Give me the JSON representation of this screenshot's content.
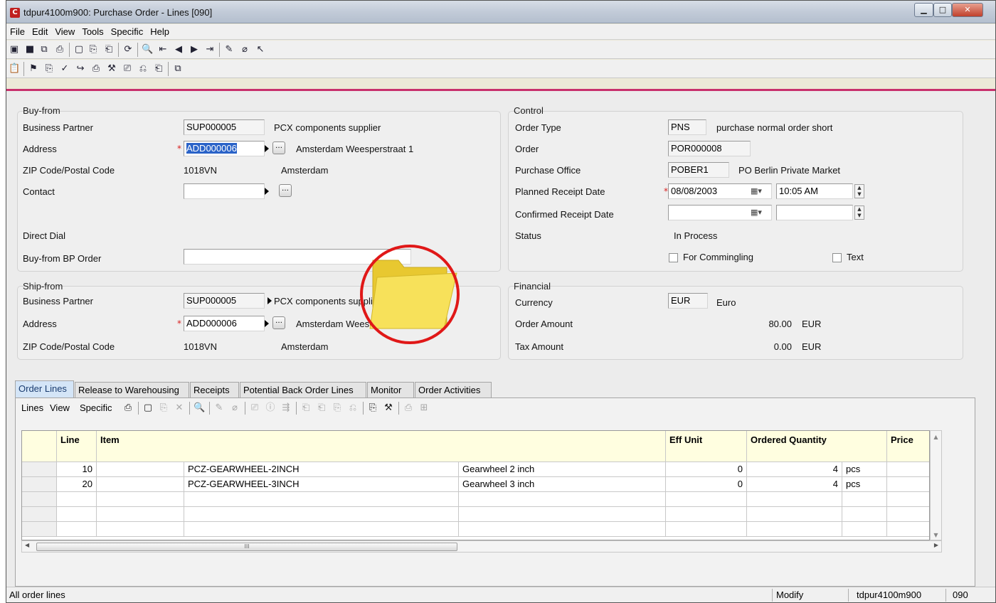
{
  "window": {
    "title": "tdpur4100m900: Purchase Order - Lines [090]",
    "app_icon": "C"
  },
  "menu": [
    "File",
    "Edit",
    "View",
    "Tools",
    "Specific",
    "Help"
  ],
  "buy_from": {
    "group_title": "Buy-from",
    "bp_label": "Business Partner",
    "bp_value": "SUP000005",
    "bp_name": "PCX components supplier",
    "address_label": "Address",
    "address_value": "ADD000006",
    "address_text": "Amsterdam Weesperstraat 1",
    "zip_label": "ZIP Code/Postal Code",
    "zip_value": "1018VN",
    "city": "Amsterdam",
    "contact_label": "Contact",
    "contact_value": "",
    "direct_dial_label": "Direct Dial",
    "bp_order_label": "Buy-from BP Order",
    "bp_order_value": ""
  },
  "control": {
    "group_title": "Control",
    "order_type_label": "Order Type",
    "order_type_value": "PNS",
    "order_type_desc": "purchase normal order short",
    "order_label": "Order",
    "order_value": "POR000008",
    "office_label": "Purchase Office",
    "office_value": "POBER1",
    "office_desc": "PO Berlin Private Market",
    "planned_label": "Planned Receipt Date",
    "planned_date": "08/08/2003",
    "planned_time": "10:05 AM",
    "confirmed_label": "Confirmed Receipt Date",
    "confirmed_date": "",
    "confirmed_time": "",
    "status_label": "Status",
    "status_value": "In Process",
    "commingling_label": "For Commingling",
    "text_label": "Text"
  },
  "ship_from": {
    "group_title": "Ship-from",
    "bp_label": "Business Partner",
    "bp_value": "SUP000005",
    "bp_name": "PCX components supplier",
    "address_label": "Address",
    "address_value": "ADD000006",
    "address_text": "Amsterdam Weesperstraat 1",
    "zip_label": "ZIP Code/Postal Code",
    "zip_value": "1018VN",
    "city": "Amsterdam"
  },
  "financial": {
    "group_title": "Financial",
    "currency_label": "Currency",
    "currency_value": "EUR",
    "currency_desc": "Euro",
    "order_amount_label": "Order Amount",
    "order_amount": "80.00",
    "order_amount_cur": "EUR",
    "tax_label": "Tax Amount",
    "tax_amount": "0.00",
    "tax_cur": "EUR"
  },
  "tabs": [
    "Order Lines",
    "Release to Warehousing",
    "Receipts",
    "Potential Back Order Lines",
    "Monitor",
    "Order Activities"
  ],
  "panel_menu": [
    "Lines",
    "View",
    "Specific"
  ],
  "grid": {
    "headers": {
      "line": "Line",
      "item": "Item",
      "eff_unit": "Eff Unit",
      "ordered_qty": "Ordered Quantity",
      "price": "Price"
    },
    "rows": [
      {
        "line": "10",
        "item": "PCZ-GEARWHEEL-2INCH",
        "desc": "Gearwheel 2 inch",
        "eff_unit": "0",
        "qty": "4",
        "unit": "pcs"
      },
      {
        "line": "20",
        "item": "PCZ-GEARWHEEL-3INCH",
        "desc": "Gearwheel 3 inch",
        "eff_unit": "0",
        "qty": "4",
        "unit": "pcs"
      }
    ],
    "scroll_thumb": "III"
  },
  "status": {
    "message": "All order lines",
    "mode": "Modify",
    "session": "tdpur4100m900",
    "code": "090"
  },
  "colors": {
    "accent_bar": "#c8306c",
    "annotation_circle": "#e01818",
    "folder": "#f5d949"
  }
}
